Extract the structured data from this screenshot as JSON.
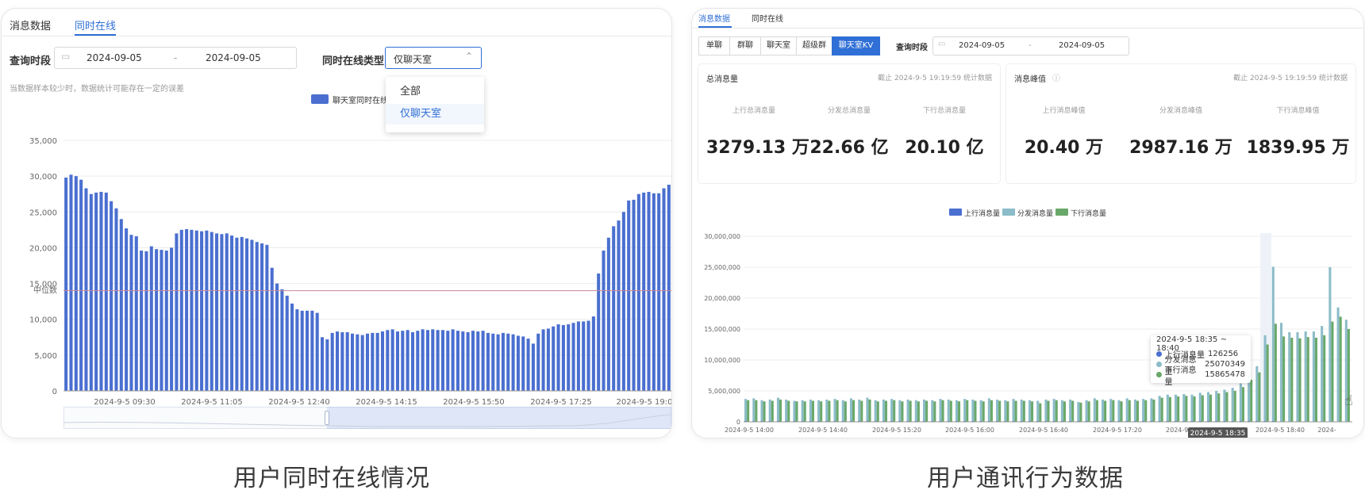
{
  "captions": {
    "left": "用户同时在线情况",
    "right": "用户通讯行为数据"
  },
  "left": {
    "tabs": [
      {
        "label": "消息数据"
      },
      {
        "label": "同时在线"
      }
    ],
    "query_label": "查询时段",
    "date_start": "2024-09-05",
    "date_sep": "-",
    "date_end": "2024-09-05",
    "type_label": "同时在线类型",
    "type_value": "仅聊天室",
    "note": "当数据样本较少时，数据统计可能存在一定的误差",
    "legend_label": "聊天室同时在线",
    "dropdown": {
      "options": [
        "全部",
        "仅聊天室"
      ],
      "selected": 1
    },
    "median_label": "中位数"
  },
  "right": {
    "tabs": [
      {
        "label": "消息数据"
      },
      {
        "label": "同时在线"
      }
    ],
    "segments": [
      "单聊",
      "群聊",
      "聊天室",
      "超级群",
      "聊天室KV"
    ],
    "segment_active": 4,
    "query_label": "查询时段",
    "date_start": "2024-09-05",
    "date_sep": "-",
    "date_end": "2024-09-05",
    "panel_total": {
      "title": "总消息量",
      "note": "截止 2024-9-5 19:19:59 统计数据",
      "stats": [
        {
          "label": "上行总消息量",
          "value": "3279.13 万"
        },
        {
          "label": "分发总消息量",
          "value": "22.66 亿"
        },
        {
          "label": "下行总消息量",
          "value": "20.10 亿"
        }
      ]
    },
    "panel_peak": {
      "title": "消息峰值",
      "note": "截止 2024-9-5 19:19:59 统计数据",
      "stats": [
        {
          "label": "上行消息峰值",
          "value": "20.40 万"
        },
        {
          "label": "分发消息峰值",
          "value": "2987.16 万"
        },
        {
          "label": "下行消息峰值",
          "value": "1839.95 万"
        }
      ]
    },
    "tooltip": {
      "title": "2024-9-5 18:35 ~ 18:40",
      "rows": [
        {
          "label": "上行消息量",
          "value": "126256",
          "color": "#4a6fd0"
        },
        {
          "label": "分发消息量",
          "value": "25070349",
          "color": "#8cbcc9"
        },
        {
          "label": "下行消息量",
          "value": "15865478",
          "color": "#6aa86a"
        }
      ]
    },
    "axis_highlight": "2024-9-5 18:35"
  },
  "chart_data": [
    {
      "type": "bar",
      "legend": [
        "聊天室同时在线"
      ],
      "legend_position": "top",
      "grid": true,
      "ylim": [
        0,
        35000
      ],
      "yticks": [
        0,
        5000,
        10000,
        15000,
        20000,
        25000,
        30000,
        35000
      ],
      "ytick_labels": [
        "0",
        "5,000",
        "10,000",
        "15,000",
        "20,000",
        "25,000",
        "30,000",
        "35,000"
      ],
      "xtick_labels": [
        "2024-9-5 09:30",
        "2024-9-5 11:05",
        "2024-9-5 12:40",
        "2024-9-5 14:15",
        "2024-9-5 15:50",
        "2024-9-5 17:25",
        "2024-9-5 19:0"
      ],
      "reference_line": {
        "label": "中位数",
        "value": 14000
      },
      "series": [
        {
          "name": "聊天室同时在线",
          "color": "#4a6fd0",
          "values": [
            29800,
            30200,
            30000,
            29500,
            28300,
            27500,
            27700,
            27800,
            27700,
            26500,
            25500,
            24000,
            22700,
            21800,
            21600,
            19600,
            19500,
            20200,
            19800,
            19700,
            19600,
            20000,
            22000,
            22500,
            22600,
            22500,
            22400,
            22300,
            22400,
            22200,
            22000,
            21900,
            22000,
            21700,
            21400,
            21500,
            21300,
            21100,
            20800,
            20600,
            20400,
            17200,
            15000,
            14200,
            13300,
            12200,
            11400,
            11200,
            11200,
            11200,
            10900,
            7500,
            7200,
            8100,
            8300,
            8200,
            8200,
            8000,
            7900,
            7800,
            8000,
            8100,
            8100,
            8300,
            8500,
            8600,
            8300,
            8400,
            8500,
            8200,
            8400,
            8600,
            8500,
            8600,
            8500,
            8500,
            8400,
            8600,
            8400,
            8300,
            8200,
            8400,
            8300,
            8400,
            8100,
            8000,
            7900,
            8100,
            8000,
            7900,
            7700,
            7600,
            7300,
            6600,
            8000,
            8600,
            8700,
            9000,
            9300,
            9200,
            9300,
            9500,
            9700,
            9700,
            9800,
            10400,
            16400,
            19600,
            21400,
            23000,
            23800,
            25000,
            26600,
            26700,
            27500,
            27700,
            27800,
            27600,
            27600,
            28300,
            28800
          ]
        }
      ]
    },
    {
      "type": "bar",
      "legend": [
        "上行消息量",
        "分发消息量",
        "下行消息量"
      ],
      "legend_position": "top",
      "grid": true,
      "ylim": [
        0,
        30000000
      ],
      "yticks": [
        0,
        5000000,
        10000000,
        15000000,
        20000000,
        25000000,
        30000000
      ],
      "ytick_labels": [
        "0",
        "5,000,000",
        "10,000,000",
        "15,000,000",
        "20,000,000",
        "25,000,000",
        "30,000,000"
      ],
      "xtick_labels": [
        "2024-9-5 14:00",
        "2024-9-5 14:40",
        "2024-9-5 15:20",
        "2024-9-5 16:00",
        "2024-9-5 16:40",
        "2024-9-5 17:20",
        "2024-9-5 18:00",
        "2024-9-5 18:35",
        "2024-9-5 18:40",
        "2024-"
      ],
      "series": [
        {
          "name": "上行消息量",
          "color": "#4a6fd0",
          "values": [
            130000,
            120000,
            120000,
            125000,
            120000,
            120000,
            118000,
            120000,
            122000,
            120000,
            119000,
            121000,
            120000,
            118000,
            120000,
            121000,
            120000,
            119000,
            120000,
            122000,
            120000,
            118000,
            119000,
            120000,
            121000,
            120000,
            120000,
            119000,
            118000,
            120000,
            121000,
            120000,
            119000,
            120000,
            122000,
            121000,
            120000,
            119000,
            120000,
            121000,
            120000,
            122000,
            123000,
            124000,
            125000,
            124000,
            125000,
            126000,
            125000,
            126000,
            127000,
            126000,
            125000,
            126000,
            126000,
            126000,
            127000,
            128000,
            127000,
            126000,
            126000,
            127000,
            128000,
            126000,
            127000,
            126000
          ]
        },
        {
          "name": "分发消息量",
          "color": "#8cbcc9",
          "values": [
            3700000,
            3800000,
            3500000,
            3600000,
            3900000,
            3600000,
            3400000,
            3500000,
            3600000,
            3500000,
            3600000,
            3700000,
            3500000,
            3800000,
            3600000,
            3900000,
            3500000,
            3600000,
            3700000,
            3500000,
            3600000,
            3500000,
            3600000,
            3500000,
            3700000,
            3600000,
            3500000,
            3700000,
            3600000,
            3500000,
            3800000,
            3600000,
            3500000,
            3700000,
            3600000,
            3500000,
            3400000,
            3600000,
            3700000,
            3500000,
            3600000,
            3200000,
            3500000,
            3800000,
            3600000,
            3700000,
            3500000,
            3800000,
            3600000,
            3700000,
            3800000,
            4200000,
            4400000,
            4400000,
            4500000,
            4400000,
            4700000,
            4800000,
            5000000,
            5200000,
            5500000,
            6200000,
            7800000,
            9000000,
            14000000,
            25070349,
            16000000,
            14500000,
            14500000,
            14600000,
            14600000,
            15500000,
            25000000,
            18500000,
            16500000
          ]
        },
        {
          "name": "下行消息量",
          "color": "#6aa86a",
          "values": [
            3500000,
            3500000,
            3300000,
            3400000,
            3600000,
            3400000,
            3300000,
            3300000,
            3400000,
            3300000,
            3400000,
            3500000,
            3300000,
            3500000,
            3400000,
            3600000,
            3300000,
            3400000,
            3500000,
            3300000,
            3400000,
            3300000,
            3400000,
            3300000,
            3500000,
            3400000,
            3300000,
            3500000,
            3400000,
            3300000,
            3500000,
            3400000,
            3300000,
            3400000,
            3400000,
            3300000,
            3000000,
            3400000,
            3500000,
            3300000,
            3400000,
            3100000,
            3300000,
            3500000,
            3400000,
            3500000,
            3300000,
            3500000,
            3400000,
            3500000,
            3600000,
            3900000,
            4000000,
            4100000,
            4200000,
            4100000,
            4300000,
            4400000,
            4600000,
            4800000,
            5000000,
            5600000,
            6800000,
            8000000,
            12500000,
            15865478,
            13800000,
            13600000,
            13500000,
            13700000,
            13600000,
            14000000,
            16200000,
            17000000,
            15000000
          ]
        }
      ]
    }
  ]
}
